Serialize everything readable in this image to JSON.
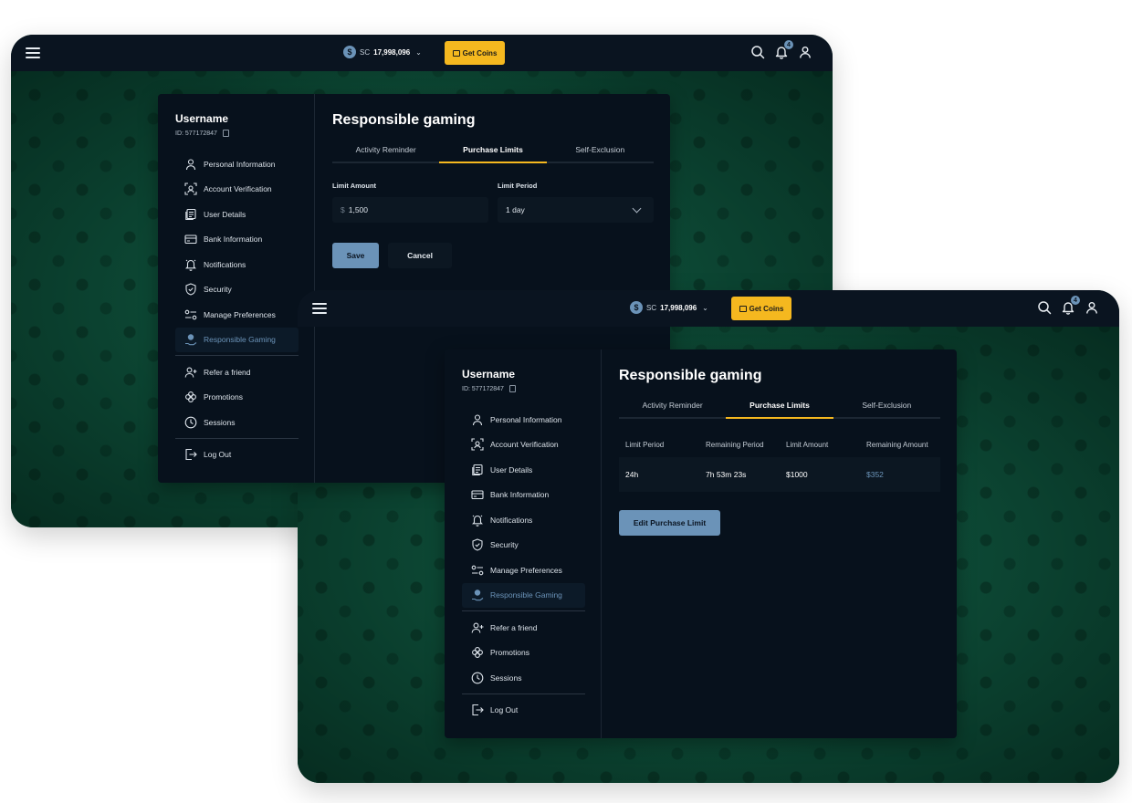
{
  "brand_colors": {
    "accent": "#6b93b8",
    "get_coins": "#f5b81f",
    "panel": "#07111c",
    "background": "#0d4a36"
  },
  "header": {
    "currency_icon": "$",
    "currency_label": "SC",
    "balance": "17,998,096",
    "get_coins_label": "Get Coins",
    "notification_count": "4"
  },
  "profile": {
    "username": "Username",
    "id_text": "ID: 577172847"
  },
  "nav": {
    "items": [
      {
        "label": "Personal Information",
        "icon": "user-icon"
      },
      {
        "label": "Account Verification",
        "icon": "face-scan-icon"
      },
      {
        "label": "User Details",
        "icon": "documents-icon"
      },
      {
        "label": "Bank Information",
        "icon": "card-icon"
      },
      {
        "label": "Notifications",
        "icon": "bell-icon"
      },
      {
        "label": "Security",
        "icon": "shield-icon"
      },
      {
        "label": "Manage Preferences",
        "icon": "sliders-icon"
      },
      {
        "label": "Responsible Gaming",
        "icon": "coin-hand-icon",
        "active": true
      }
    ],
    "secondary": [
      {
        "label": "Refer a friend",
        "icon": "user-plus-icon"
      },
      {
        "label": "Promotions",
        "icon": "clover-icon"
      },
      {
        "label": "Sessions",
        "icon": "clock-icon"
      }
    ],
    "logout": {
      "label": "Log Out",
      "icon": "logout-icon"
    }
  },
  "page": {
    "title": "Responsible gaming",
    "tabs": [
      {
        "label": "Activity Reminder"
      },
      {
        "label": "Purchase Limits",
        "active": true
      },
      {
        "label": "Self-Exclusion"
      }
    ]
  },
  "form": {
    "limit_amount_label": "Limit Amount",
    "currency_symbol": "$",
    "limit_amount_value": "1,500",
    "limit_period_label": "Limit Period",
    "limit_period_value": "1 day",
    "save_label": "Save",
    "cancel_label": "Cancel"
  },
  "limits_table": {
    "headers": [
      "Limit Period",
      "Remaining Period",
      "Limit Amount",
      "Remaining Amount"
    ],
    "rows": [
      [
        "24h",
        "7h 53m 23s",
        "$1000",
        "$352"
      ]
    ],
    "edit_label": "Edit Purchase Limit"
  }
}
